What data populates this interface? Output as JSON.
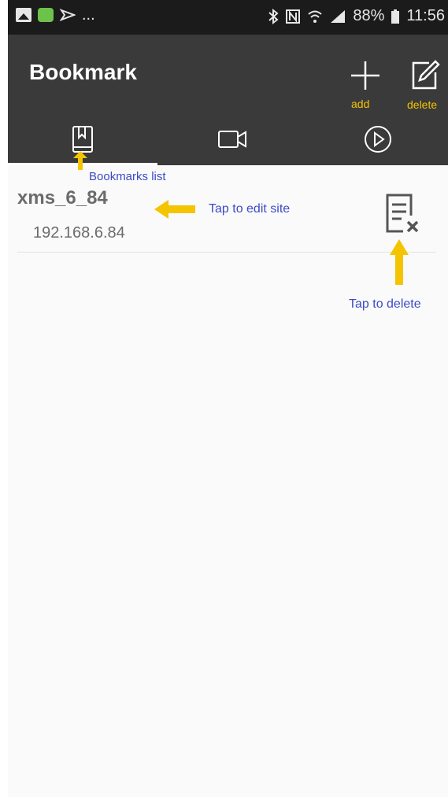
{
  "status_bar": {
    "battery": "88%",
    "time": "11:56",
    "more": "..."
  },
  "app_bar": {
    "title": "Bookmark"
  },
  "actions": {
    "add_label": "add",
    "delete_label": "delete"
  },
  "tabs": [
    {
      "name": "bookmarks",
      "icon": "bookmark-book-icon"
    },
    {
      "name": "video",
      "icon": "video-camera-icon"
    },
    {
      "name": "playback",
      "icon": "play-circle-icon"
    }
  ],
  "bookmarks": [
    {
      "name": "xms_6_84",
      "address": "192.168.6.84"
    }
  ],
  "annotations": {
    "bookmarks_list": "Bookmarks list",
    "tap_to_edit": "Tap to edit site",
    "tap_to_delete": "Tap to delete"
  },
  "colors": {
    "app_bar": "#3a3a3a",
    "status_bar": "#1b1b1b",
    "annotation_text": "#3b4bc4",
    "annotation_arrow": "#f5c400"
  }
}
